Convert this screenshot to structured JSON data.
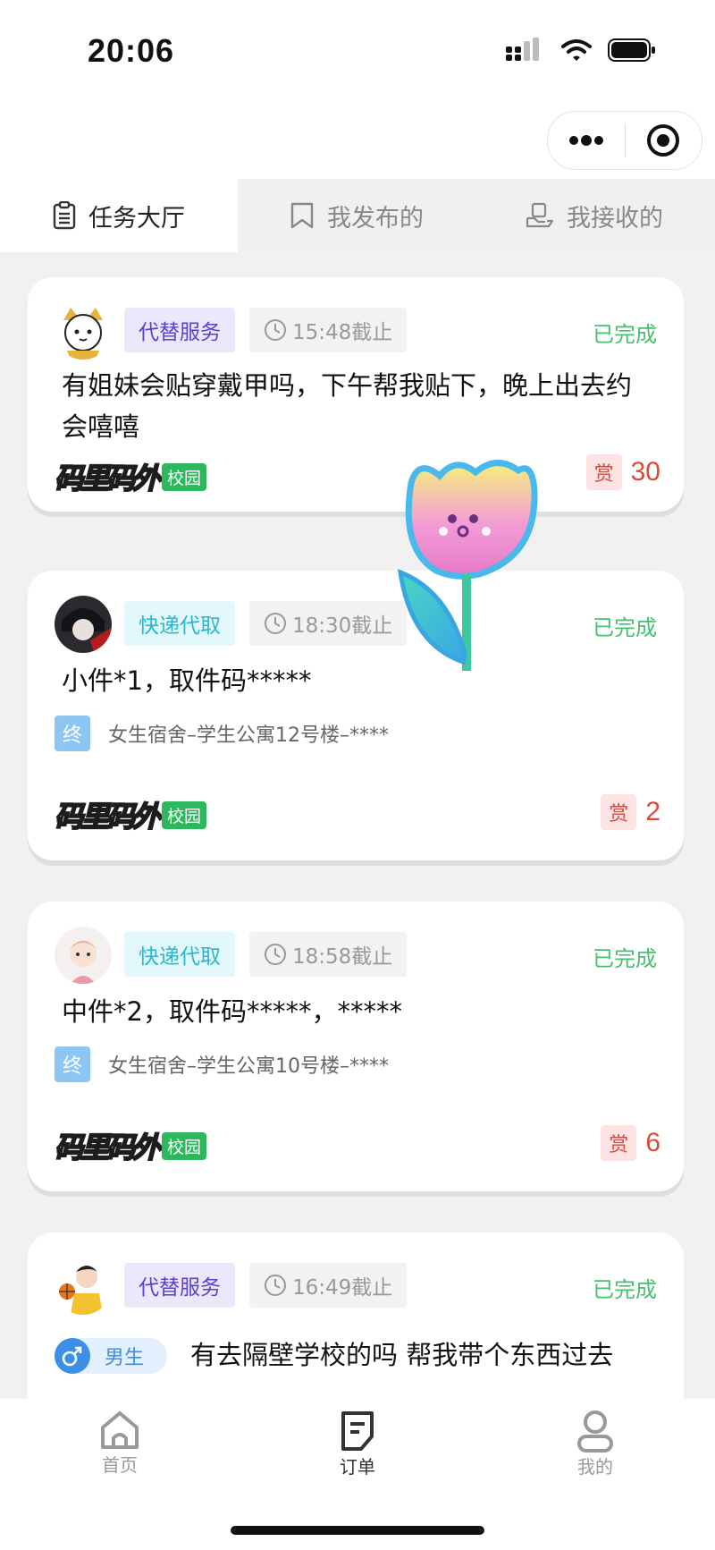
{
  "status_bar": {
    "time": "20:06"
  },
  "tabs": [
    {
      "label": "任务大厅",
      "icon": "clipboard-icon",
      "active": true
    },
    {
      "label": "我发布的",
      "icon": "bookmark-icon",
      "active": false
    },
    {
      "label": "我接收的",
      "icon": "receive-icon",
      "active": false
    }
  ],
  "orders": [
    {
      "category": "代替服务",
      "deadline": "15:48截止",
      "status": "已完成",
      "description": "有姐妹会贴穿戴甲吗，下午帮我贴下，晚上出去约会嘻嘻",
      "brand": "码里码外",
      "brand_tag": "校园",
      "reward_label": "赏",
      "reward": "30"
    },
    {
      "category": "快递代取",
      "deadline": "18:30截止",
      "status": "已完成",
      "description": "小件*1，取件码*****",
      "dest_label": "终",
      "destination": "女生宿舍–学生公寓12号楼–****",
      "brand": "码里码外",
      "brand_tag": "校园",
      "reward_label": "赏",
      "reward": "2"
    },
    {
      "category": "快递代取",
      "deadline": "18:58截止",
      "status": "已完成",
      "description": "中件*2，取件码*****，*****",
      "dest_label": "终",
      "destination": "女生宿舍–学生公寓10号楼–****",
      "brand": "码里码外",
      "brand_tag": "校园",
      "reward_label": "赏",
      "reward": "6"
    },
    {
      "category": "代替服务",
      "deadline": "16:49截止",
      "status": "已完成",
      "gender_label": "男生",
      "description": "有去隔壁学校的吗 帮我带个东西过去"
    }
  ],
  "bottom_nav": [
    {
      "label": "首页",
      "icon": "home-icon",
      "active": false
    },
    {
      "label": "订单",
      "icon": "order-icon",
      "active": true
    },
    {
      "label": "我的",
      "icon": "profile-icon",
      "active": false
    }
  ],
  "colors": {
    "completed": "#47c070",
    "reward": "#d84a3c",
    "purple_tag": "#5a3fd1",
    "cyan_tag": "#29b6d0",
    "brand_tag": "#2db85e"
  }
}
